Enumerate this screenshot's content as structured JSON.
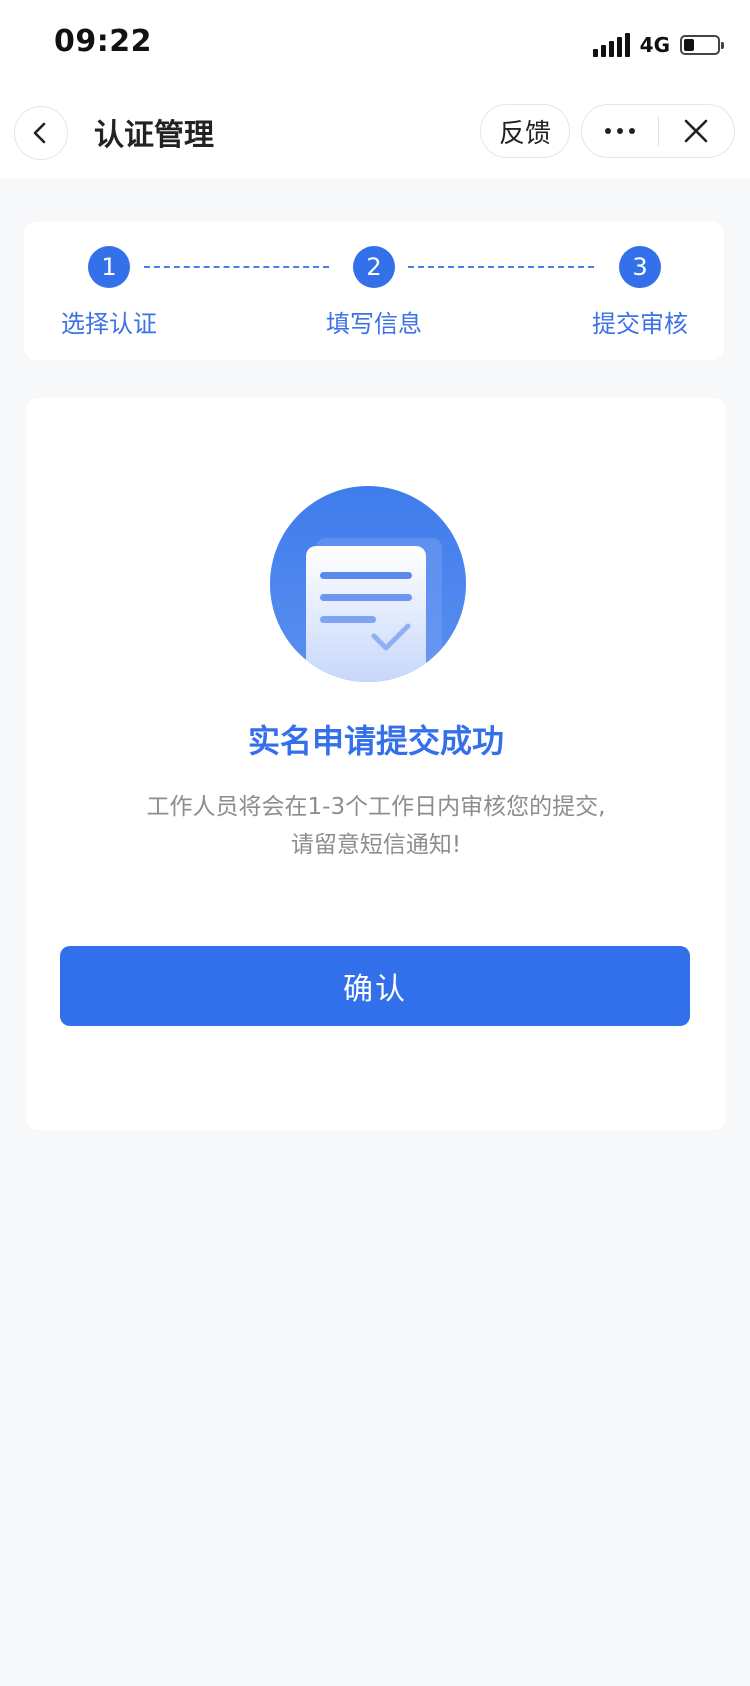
{
  "status_bar": {
    "time": "09:22",
    "network": "4G"
  },
  "nav": {
    "title": "认证管理",
    "feedback_label": "反馈"
  },
  "steps": [
    {
      "number": "1",
      "label": "选择认证"
    },
    {
      "number": "2",
      "label": "填写信息"
    },
    {
      "number": "3",
      "label": "提交审核"
    }
  ],
  "result": {
    "title": "实名申请提交成功",
    "description_line1": "工作人员将会在1-3个工作日内审核您的提交,",
    "description_line2": "请留意短信通知!",
    "confirm_label": "确认"
  },
  "colors": {
    "primary": "#3370ea",
    "background": "#f7f8f9",
    "muted_text": "#8d8d8d"
  }
}
